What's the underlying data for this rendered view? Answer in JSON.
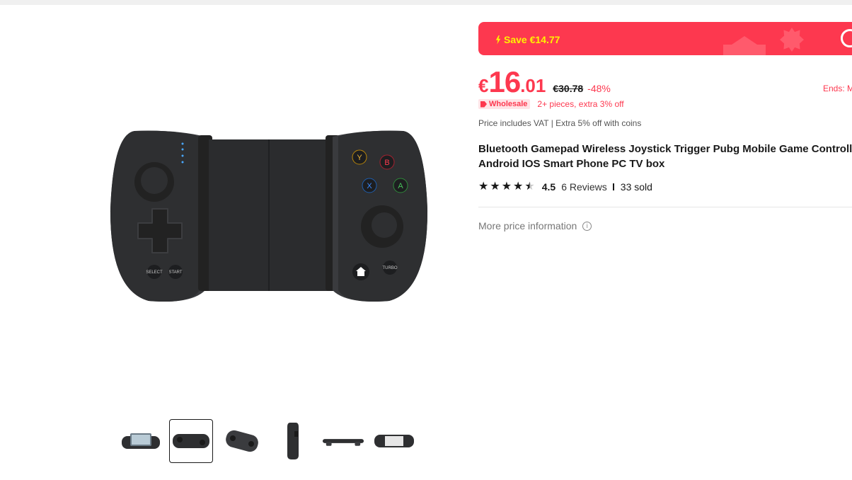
{
  "promo": {
    "save_label": "Save €14.77"
  },
  "price": {
    "currency": "€",
    "integer": "16",
    "decimal": ".01",
    "original": "€30.78",
    "discount": "-48%"
  },
  "ends_label": "Ends: M",
  "wholesale": {
    "badge": "Wholesale",
    "text": "2+ pieces, extra 3% off"
  },
  "vat_text": "Price includes VAT |  Extra 5% off with coins",
  "product": {
    "title_line1": "Bluetooth Gamepad Wireless Joystick Trigger Pubg Mobile Game Controller",
    "title_line2": "Android IOS Smart Phone PC TV box"
  },
  "rating": {
    "value": "4.5",
    "reviews": "6 Reviews",
    "sold": "33 sold",
    "stars": 4.5
  },
  "more_price": {
    "label": "More price information"
  },
  "gamepad_buttons": {
    "y": "Y",
    "b": "B",
    "x": "X",
    "a": "A",
    "select": "SELECT",
    "start": "START",
    "turbo": "TURBO"
  },
  "colors": {
    "accent": "#fd384f",
    "promo_text": "#fff200",
    "text": "#191919"
  },
  "thumbnails": {
    "count": 6,
    "selected_index": 1
  }
}
